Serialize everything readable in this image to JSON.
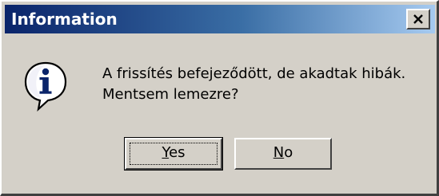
{
  "window": {
    "title": "Information",
    "close_icon": "close-icon"
  },
  "message": {
    "icon": "info-icon",
    "line1": "A frissítés befejeződött, de akadtak hibák.",
    "line2": "Mentsem lemezre?"
  },
  "buttons": {
    "yes": {
      "mnemonic": "Y",
      "rest": "es",
      "is_default": true
    },
    "no": {
      "mnemonic": "N",
      "rest": "o",
      "is_default": false
    }
  },
  "colors": {
    "face": "#d4d0c8",
    "titlebar_start": "#0a246a",
    "titlebar_end": "#a6caf0",
    "title_text": "#ffffff",
    "info_blue": "#0a246a"
  }
}
